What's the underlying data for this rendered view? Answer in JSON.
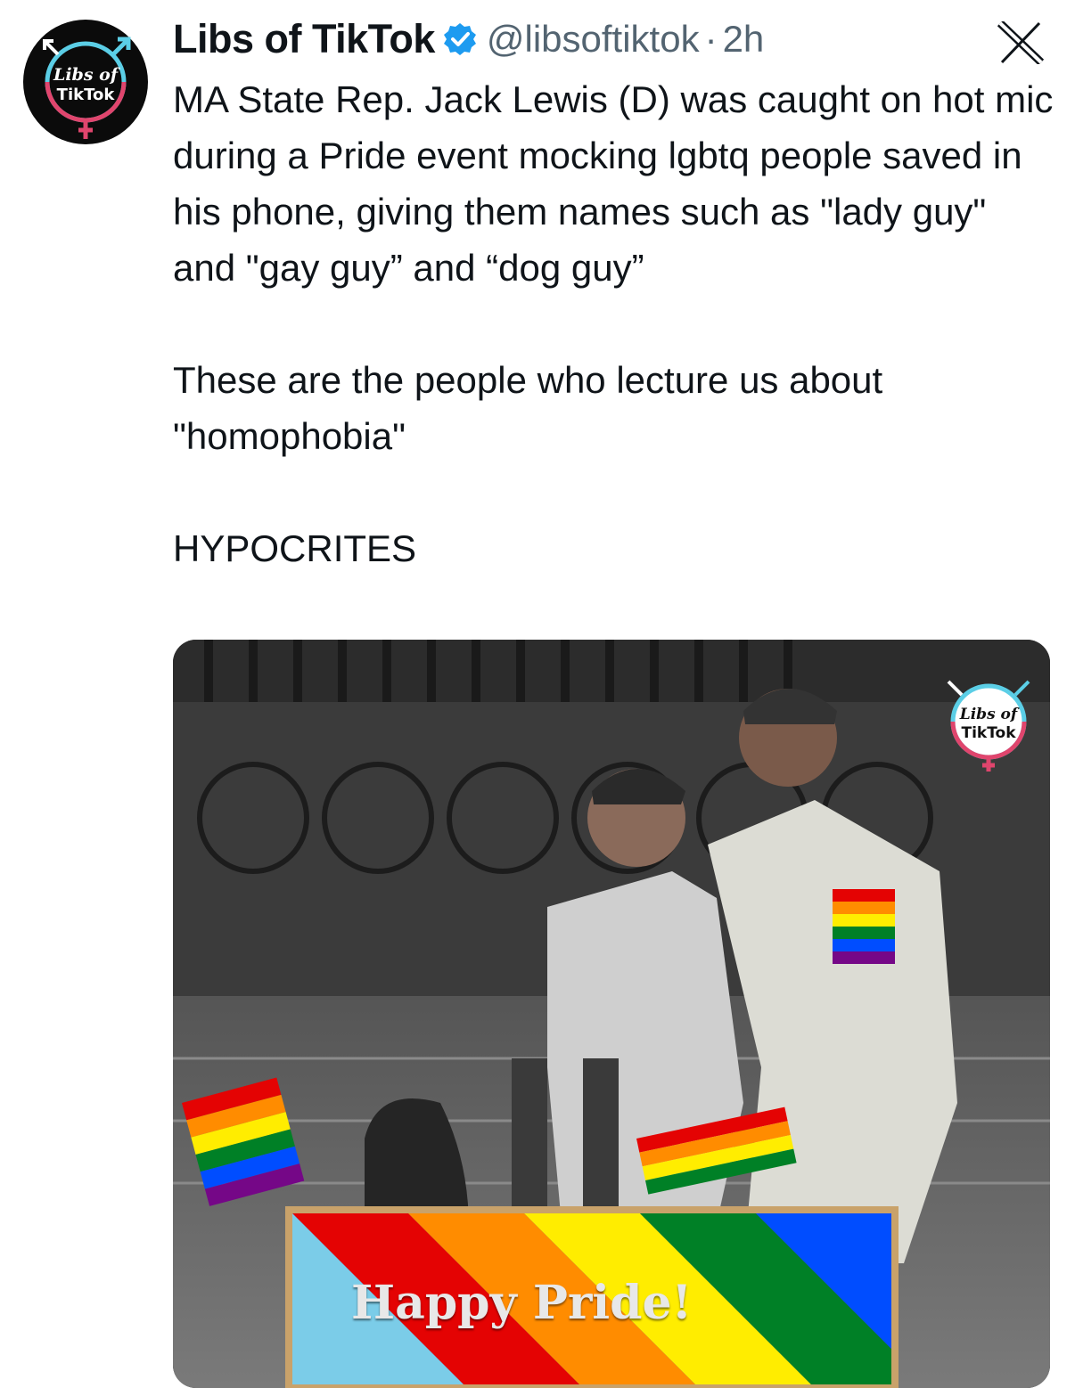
{
  "author": {
    "name": "Libs of TikTok",
    "handle": "@libsoftiktok",
    "separator": "·",
    "time": "2h",
    "avatar_text_line1": "Libs of",
    "avatar_text_line2": "TikTok",
    "verified_icon": "verified-badge-icon"
  },
  "tweet": {
    "paragraphs": [
      "MA State Rep. Jack Lewis (D) was caught on hot mic during a Pride event mocking lgbtq people saved in his phone, giving them names such as \"lady guy\" and \"gay guy” and “dog guy”",
      "These are the people who lecture us about \"homophobia\"",
      "HYPOCRITES"
    ]
  },
  "media": {
    "watermark_line1": "Libs of",
    "watermark_line2": "TikTok",
    "banner_text": "Happy Pride!"
  },
  "colors": {
    "accent_blue": "#1d9bf0",
    "secondary_text": "#536471",
    "logo_cyan": "#5bcee6",
    "logo_pink": "#e0456d"
  }
}
